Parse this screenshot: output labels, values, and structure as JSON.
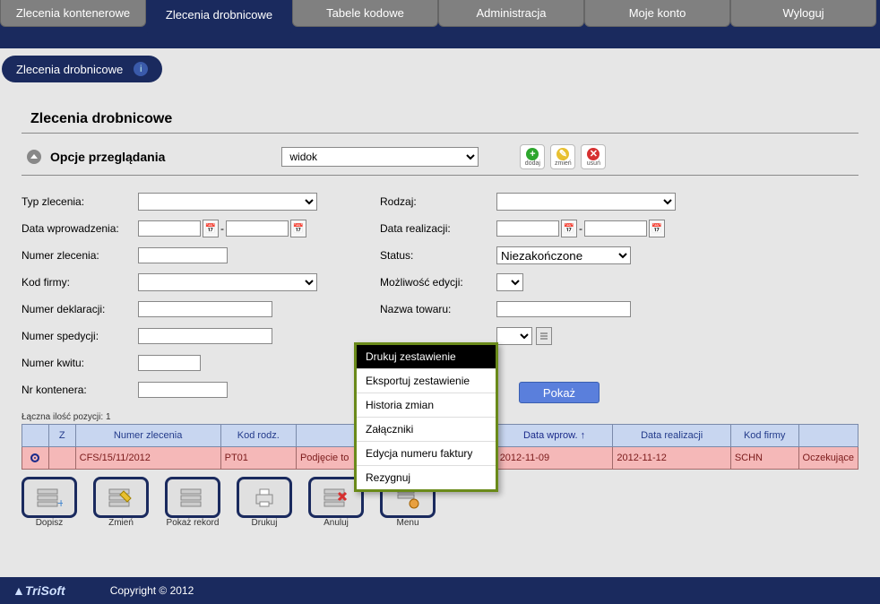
{
  "tabs": [
    "Zlecenia kontenerowe",
    "Zlecenia drobnicowe",
    "Tabele kodowe",
    "Administracja",
    "Moje konto",
    "Wyloguj"
  ],
  "active_tab": 1,
  "subheader": "Zlecenia drobnicowe",
  "section_title": "Zlecenia drobnicowe",
  "view_options": {
    "label": "Opcje przeglądania",
    "select_value": "widok",
    "add_label": "dodaj",
    "edit_label": "zmień",
    "del_label": "usuń"
  },
  "filters_left": {
    "typ": {
      "label": "Typ zlecenia:",
      "value": ""
    },
    "data_wpr": {
      "label": "Data wprowadzenia:",
      "from": "",
      "to": ""
    },
    "numer": {
      "label": "Numer zlecenia:",
      "value": ""
    },
    "kod_firmy": {
      "label": "Kod firmy:",
      "value": ""
    },
    "numer_dekl": {
      "label": "Numer deklaracji:",
      "value": ""
    },
    "numer_sped": {
      "label": "Numer spedycji:",
      "value": ""
    },
    "numer_kwitu": {
      "label": "Numer kwitu:",
      "value": ""
    },
    "nr_kont": {
      "label": "Nr kontenera:",
      "value": ""
    }
  },
  "filters_right": {
    "rodzaj": {
      "label": "Rodzaj:",
      "value": ""
    },
    "data_real": {
      "label": "Data realizacji:",
      "from": "",
      "to": ""
    },
    "status": {
      "label": "Status:",
      "value": "Niezakończone"
    },
    "edycja": {
      "label": "Możliwość edycji:",
      "value": ""
    },
    "nazwa": {
      "label": "Nazwa towaru:",
      "value": ""
    },
    "opak": {
      "label": "",
      "value": ""
    }
  },
  "show_button": "Pokaż",
  "count_prefix": "Łączna ilość pozycji: ",
  "count_value": "1",
  "table": {
    "headers": [
      "",
      "Z",
      "Numer zlecenia",
      "Kod rodz.",
      "",
      "Data wprow. ",
      "Data realizacji",
      "Kod firmy",
      ""
    ],
    "sort_arrow": "↑",
    "row": {
      "selected": true,
      "z": "",
      "numer": "CFS/15/11/2012",
      "kod_rodz": "PT01",
      "desc": "Podjęcie to",
      "data_wprow": "2012-11-09",
      "data_real": "2012-11-12",
      "kod_firmy": "SCHN",
      "status": "Oczekujące"
    }
  },
  "toolbar": [
    "Dopisz",
    "Zmień",
    "Pokaż rekord",
    "Drukuj",
    "Anuluj",
    "Menu"
  ],
  "context_menu": [
    "Drukuj zestawienie",
    "Eksportuj zestawienie",
    "Historia zmian",
    "Załączniki",
    "Edycja numeru faktury",
    "Rezygnuj"
  ],
  "context_active": 0,
  "footer": {
    "brand": "▲TriSoft",
    "copy": "Copyright © 2012"
  }
}
